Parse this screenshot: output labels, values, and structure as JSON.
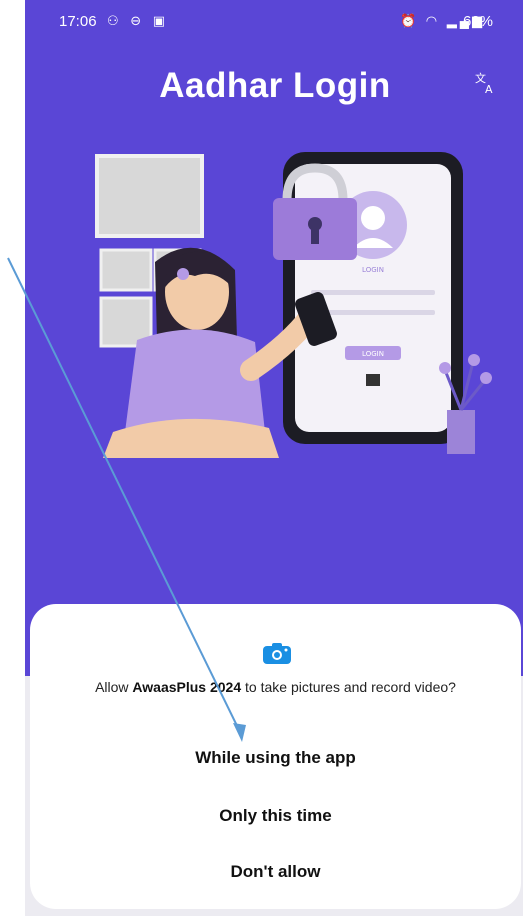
{
  "status_bar": {
    "time": "17:06",
    "left_icons": [
      "notification-icon",
      "sync-icon",
      "message-icon"
    ],
    "right_icons": [
      "alarm-icon",
      "wifi-icon",
      "signal-icon"
    ],
    "battery": "62%"
  },
  "header": {
    "title": "Aadhar Login",
    "translate_icon": "translate-icon"
  },
  "illustration": {
    "login_label": "LOGIN",
    "button_label": "LOGIN"
  },
  "dialog": {
    "icon": "camera-icon",
    "prompt_prefix": "Allow ",
    "app_name": "AwaasPlus 2024",
    "prompt_suffix": " to take pictures and record video?",
    "options": [
      {
        "label": "While using the app"
      },
      {
        "label": "Only this time"
      },
      {
        "label": "Don't allow"
      }
    ]
  },
  "colors": {
    "background": "#5a46d6",
    "dialog": "#ffffff",
    "accent_lavender": "#b49ae6",
    "annotation_arrow": "#5b9bd5"
  }
}
